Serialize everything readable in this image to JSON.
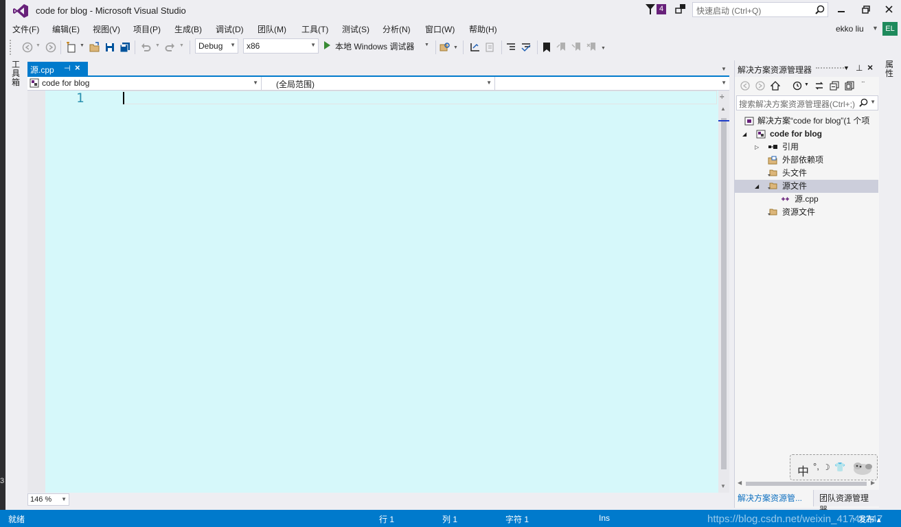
{
  "window": {
    "title": "code for blog - Microsoft Visual Studio",
    "notification_count": "4",
    "quick_launch_placeholder": "快速启动 (Ctrl+Q)"
  },
  "menu": {
    "items": [
      "文件(F)",
      "编辑(E)",
      "视图(V)",
      "项目(P)",
      "生成(B)",
      "调试(D)",
      "团队(M)",
      "工具(T)",
      "测试(S)",
      "分析(N)",
      "窗口(W)",
      "帮助(H)"
    ],
    "user": "ekko liu",
    "avatar": "EL"
  },
  "toolbar": {
    "config": "Debug",
    "platform": "x86",
    "run_label": "本地 Windows 调试器"
  },
  "side_labels": {
    "toolbox": "工具箱",
    "properties": "属性"
  },
  "editor": {
    "tab_label": "源.cpp",
    "nav_project": "code for blog",
    "nav_scope": "(全局范围)",
    "nav_member": "",
    "line_number": "1",
    "zoom": "146 %"
  },
  "solution_explorer": {
    "title": "解决方案资源管理器",
    "search_placeholder": "搜索解决方案资源管理器(Ctrl+;)",
    "tree": [
      {
        "label": "解决方案“code for blog”(1 个项",
        "level": 0,
        "bold": false,
        "expander": ""
      },
      {
        "label": "code for blog",
        "level": 1,
        "bold": true,
        "expander": "◢"
      },
      {
        "label": "引用",
        "level": 2,
        "bold": false,
        "expander": "▷"
      },
      {
        "label": "外部依赖项",
        "level": 2,
        "bold": false,
        "expander": ""
      },
      {
        "label": "头文件",
        "level": 2,
        "bold": false,
        "expander": ""
      },
      {
        "label": "源文件",
        "level": 2,
        "bold": false,
        "expander": "◢",
        "selected": true
      },
      {
        "label": "源.cpp",
        "level": 3,
        "bold": false,
        "expander": ""
      },
      {
        "label": "资源文件",
        "level": 2,
        "bold": false,
        "expander": ""
      }
    ],
    "bottom_tab_active": "解决方案资源管...",
    "bottom_tab_other": "团队资源管理器"
  },
  "ime": {
    "lang": "中"
  },
  "statusbar": {
    "ready": "就绪",
    "line": "行 1",
    "col": "列 1",
    "char": "字符 1",
    "mode": "Ins",
    "publish": "↑ 发布 ▴",
    "watermark": "https://blog.csdn.net/weixin_41743247"
  },
  "left_edge_label": "3",
  "colors": {
    "accent": "#007acc",
    "editor_bg": "#d6f8fa",
    "vs_purple": "#68217a",
    "run_green": "#388a34"
  }
}
